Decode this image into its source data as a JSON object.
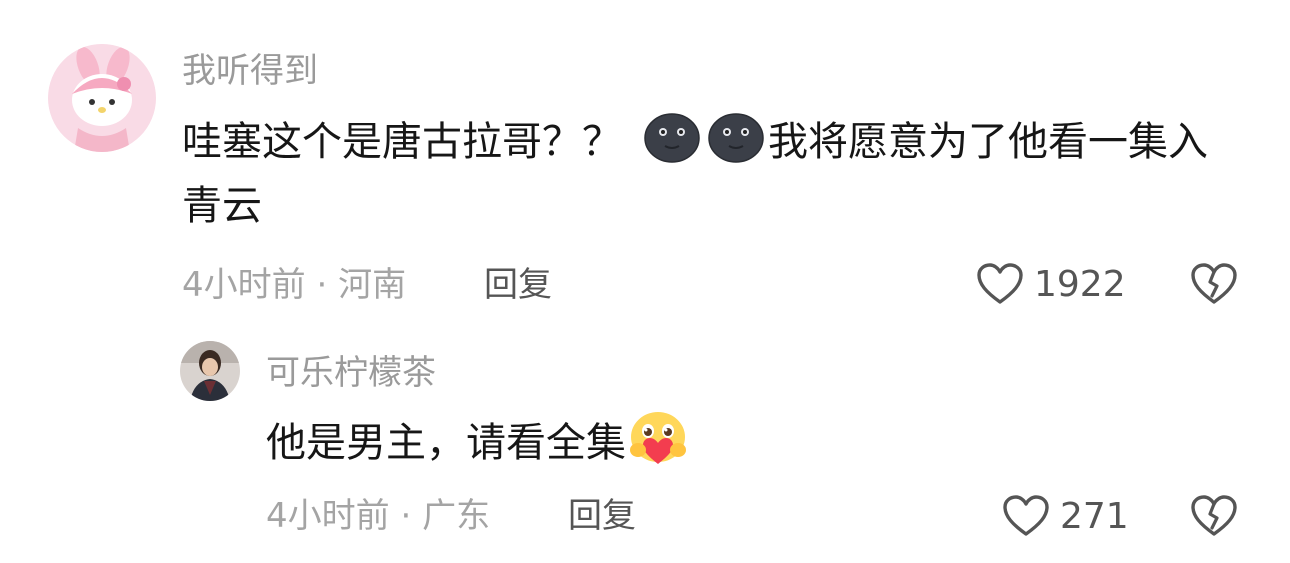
{
  "comments": [
    {
      "avatar_icon": "pink-bunny-avatar",
      "username": "我听得到",
      "text_before_emoji": "哇塞这个是唐古拉哥？？",
      "emojis": [
        "new-moon-face-icon",
        "new-moon-face-icon"
      ],
      "text_after_emoji": "我将愿意为了他看一集入青云",
      "time": "4小时前",
      "location": "河南",
      "reply_label": "回复",
      "like_count": "1922"
    },
    {
      "avatar_icon": "person-photo-avatar",
      "username": "可乐柠檬茶",
      "text": "他是男主，请看全集",
      "emojis": [
        "hugging-heart-emoji"
      ],
      "time": "4小时前",
      "location": "广东",
      "reply_label": "回复",
      "like_count": "271"
    }
  ],
  "colors": {
    "username": "#9a9a9a",
    "content": "#161616",
    "meta": "#a4a4a4",
    "action": "#555555"
  }
}
